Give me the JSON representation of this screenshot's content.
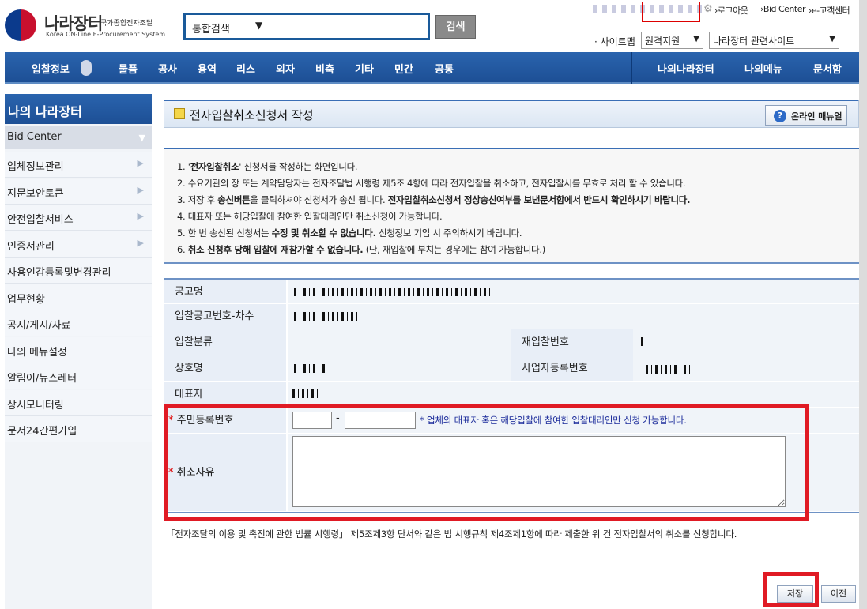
{
  "header": {
    "logo_main": "나라장터",
    "logo_sub": "국가종합전자조달",
    "logo_en": "Korea ON-Line E-Procurement System",
    "search_scope": "통합검색",
    "search_button": "검색",
    "util_links": [
      "›로그아웃",
      "›Bid Center",
      "›e-고객센터"
    ],
    "sitemap_label": "· 사이트맵",
    "remote_support": "원격지원",
    "related_sites": "나라장터 관련사이트"
  },
  "gnb": {
    "items": [
      "입찰정보",
      "물품",
      "공사",
      "용역",
      "리스",
      "외자",
      "비축",
      "기타",
      "민간",
      "공통"
    ],
    "right_items": [
      "나의나라장터",
      "나의메뉴",
      "문서함"
    ]
  },
  "sidebar": {
    "title": "나의 나라장터",
    "current": "Bid Center",
    "items": [
      {
        "label": "업체정보관리",
        "has_arrow": true
      },
      {
        "label": "지문보안토큰",
        "has_arrow": true
      },
      {
        "label": "안전입찰서비스",
        "has_arrow": true
      },
      {
        "label": "인증서관리",
        "has_arrow": true
      },
      {
        "label": "사용인감등록및변경관리",
        "has_arrow": false
      },
      {
        "label": "업무현황",
        "has_arrow": false
      },
      {
        "label": "공지/게시/자료",
        "has_arrow": false
      },
      {
        "label": "나의 메뉴설정",
        "has_arrow": false
      },
      {
        "label": "알림이/뉴스레터",
        "has_arrow": false
      },
      {
        "label": "상시모니터링",
        "has_arrow": false
      },
      {
        "label": "문서24간편가입",
        "has_arrow": false
      }
    ]
  },
  "page": {
    "title": "전자입찰취소신청서 작성",
    "manual_button": "온라인 매뉴얼"
  },
  "notice": {
    "l1_a": "1. '",
    "l1_b": "전자입찰취소",
    "l1_c": "' 신청서를 작성하는 화면입니다.",
    "l2": "2. 수요기관의 장 또는 계약담당자는 전자조달법 시행령 제5조 4항에 따라 전자입찰을 취소하고, 전자입찰서를 무효로 처리 할 수 있습니다.",
    "l3_a": "3. 저장 후 ",
    "l3_b": "송신버튼",
    "l3_c": "을 클릭하셔야 신청서가 송신 됩니다. ",
    "l3_d": "전자입찰취소신청서 정상송신여부를 보낸문서함에서 반드시 확인하시기 바랍니다.",
    "l4": "4. 대표자 또는 해당입찰에 참여한 입찰대리인만 취소신청이 가능합니다.",
    "l5_a": "5. 한 번 송신된 신청서는 ",
    "l5_b": "수정 및 취소할 수 없습니다.",
    "l5_c": " 신청정보 기입 시 주의하시기 바랍니다.",
    "l6_a": "6. ",
    "l6_b": "취소 신청후 당해 입찰에 재참가할 수 없습니다.",
    "l6_c": " (단, 재입찰에 부치는 경우에는 참여 가능합니다.)"
  },
  "form": {
    "notice_name_label": "공고명",
    "notice_no_label": "입찰공고번호-차수",
    "bid_class_label": "입찰분류",
    "rebid_no_label": "재입찰번호",
    "company_label": "상호명",
    "biz_reg_label": "사업자등록번호",
    "ceo_label": "대표자",
    "rrn_label": "주민등록번호",
    "rrn_dash": "-",
    "rrn_note": "* 업체의 대표자 혹은 해당입찰에 참여한 입찰대리인만 신청 가능합니다.",
    "reason_label": "취소사유",
    "required_mark": "*"
  },
  "legal": "「전자조달의 이용 및 촉진에 관한 법률 시행령」 제5조제3항 단서와 같은 법 시행규칙 제4조제1항에 따라 제출한 위 건 전자입찰서의 취소를 신청합니다.",
  "buttons": {
    "save": "저장",
    "prev": "이전"
  },
  "colors": {
    "brand_blue": "#1d4f95",
    "highlight_red": "#e01a24"
  }
}
